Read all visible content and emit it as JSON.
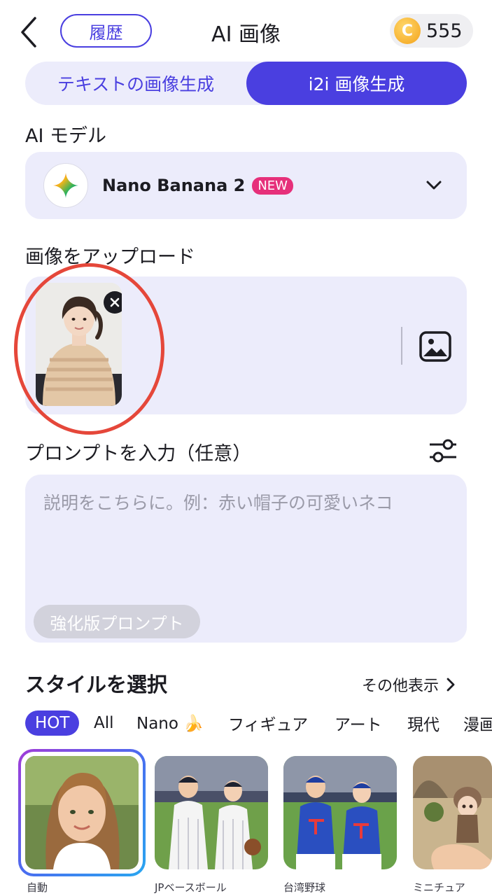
{
  "header": {
    "history_label": "履歴",
    "title": "AI 画像",
    "coin_symbol": "C",
    "coins": "555"
  },
  "mode_tabs": [
    {
      "label": "テキストの画像生成",
      "active": false
    },
    {
      "label": "i2i 画像生成",
      "active": true
    }
  ],
  "model": {
    "section_label": "AI モデル",
    "name": "Nano Banana 2",
    "badge": "NEW"
  },
  "upload": {
    "section_label": "画像をアップロード"
  },
  "prompt": {
    "section_label": "プロンプトを入力（任意）",
    "placeholder": "説明をこちらに。例：赤い帽子の可愛いネコ",
    "value": "",
    "enhance_label": "強化版プロンプト"
  },
  "styles": {
    "title": "スタイルを選択",
    "more_label": "その他表示",
    "categories": [
      "HOT",
      "All",
      "Nano 🍌",
      "フィギュア",
      "アート",
      "現代",
      "漫画"
    ],
    "active_category": "HOT",
    "cards": [
      {
        "label": "自動",
        "selected": true
      },
      {
        "label": "JPベースボール",
        "selected": false
      },
      {
        "label": "台湾野球",
        "selected": false
      },
      {
        "label": "ミニチュア",
        "selected": false
      }
    ]
  },
  "colors": {
    "accent": "#4a3fe0",
    "panel": "#ececfb",
    "badge": "#e6307a",
    "highlight_ring": "#e5473a"
  }
}
